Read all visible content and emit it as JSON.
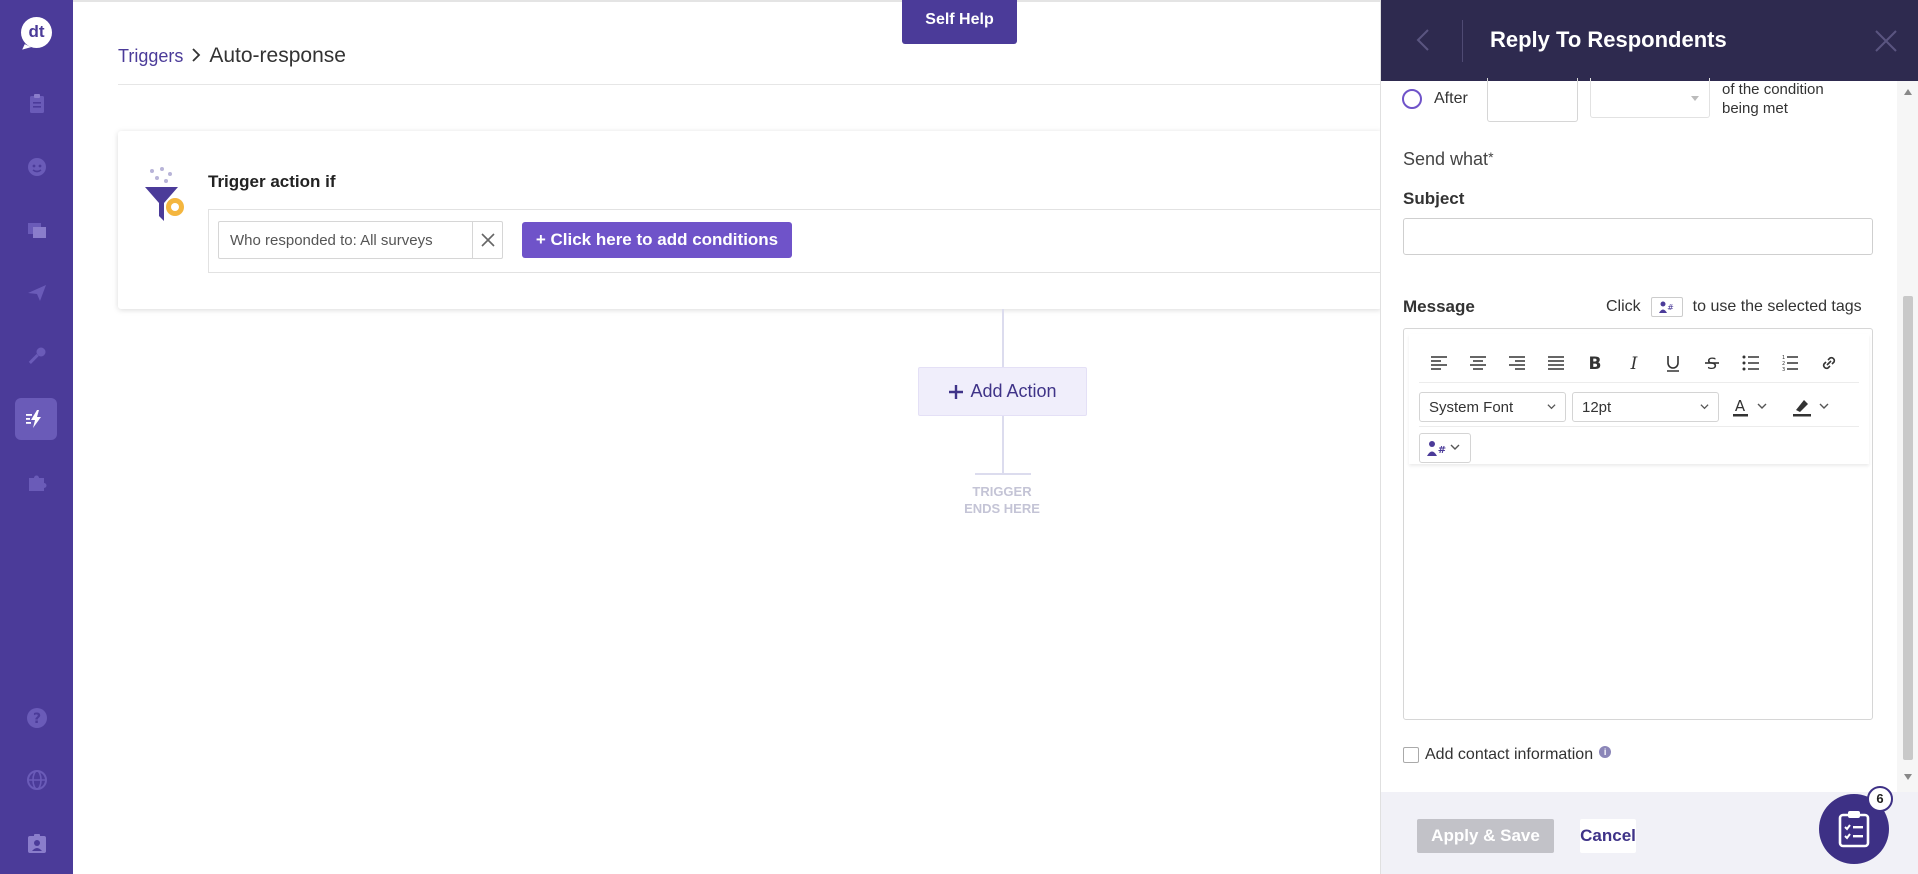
{
  "app": {
    "logo_text": "dt"
  },
  "top": {
    "self_help": "Self Help"
  },
  "breadcrumb": {
    "parent": "Triggers",
    "current": "Auto-response"
  },
  "trigger": {
    "title": "Trigger action if",
    "condition_chip": "Who responded to: All surveys",
    "add_conditions": "+ Click here to add conditions"
  },
  "flow": {
    "add_action": "Add Action",
    "end_line1": "TRIGGER",
    "end_line2": "ENDS HERE"
  },
  "panel": {
    "title": "Reply To Respondents",
    "after_label": "After",
    "after_value": "",
    "condition_text": "of the condition being met",
    "send_what": "Send what",
    "required_mark": "*",
    "subject_label": "Subject",
    "subject_value": "",
    "message_label": "Message",
    "hint_click": "Click",
    "hint_rest": "to use the selected tags",
    "font_family": "System Font",
    "font_size": "12pt",
    "add_contact": "Add contact information",
    "apply_label": "Apply & Save",
    "cancel_label": "Cancel"
  },
  "fab": {
    "badge": "6"
  },
  "colors": {
    "brand": "#4b3b99",
    "accent": "#6f53c9",
    "panel_header": "#2e2a4f"
  }
}
